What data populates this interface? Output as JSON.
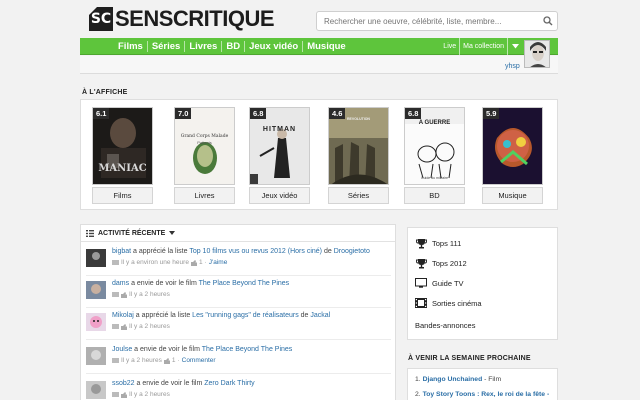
{
  "brand": {
    "logo_mark": "SC",
    "logo_text": "SENSCRITIQUE"
  },
  "search": {
    "placeholder": "Rechercher une oeuvre, célébrité, liste, membre..."
  },
  "nav": {
    "items": [
      "Films",
      "Séries",
      "Livres",
      "BD",
      "Jeux vidéo",
      "Musique"
    ],
    "live_label": "Live",
    "collection_label": "Ma collection"
  },
  "user": {
    "username": "yhsp"
  },
  "affiche": {
    "title": "À L'AFFICHE",
    "cards": [
      {
        "rating": "6.1",
        "category": "Films",
        "poster_text": "MANIAC"
      },
      {
        "rating": "7.0",
        "category": "Livres",
        "poster_text": "Grand Corps Malade",
        "poster_sub": "Patients"
      },
      {
        "rating": "6.8",
        "category": "Jeux vidéo",
        "poster_text": "HITMAN"
      },
      {
        "rating": "4.6",
        "category": "Séries",
        "poster_text": "REVOLUTION"
      },
      {
        "rating": "6.8",
        "category": "BD",
        "poster_text": "A GUERRE",
        "poster_sub": "Guide du militaire"
      },
      {
        "rating": "5.9",
        "category": "Musique",
        "poster_text": ""
      }
    ]
  },
  "activity": {
    "title": "ACTIVITÉ RÉCENTE",
    "items": [
      {
        "user": "bigbat",
        "verb": " a apprécié la liste ",
        "target": "Top 10 films vus ou revus 2012 (Hors ciné)",
        "suffix": " de ",
        "target2": "Droogietoto",
        "time": "Il y a environ une heure",
        "count": "1",
        "action": "J'aime"
      },
      {
        "user": "dams",
        "verb": " a envie de voir le film ",
        "target": "The Place Beyond The Pines",
        "suffix": "",
        "target2": "",
        "time": "Il y a 2 heures",
        "count": "",
        "action": ""
      },
      {
        "user": "Mikolaj",
        "verb": " a apprécié la liste ",
        "target": "Les \"running gags\" de réalisateurs",
        "suffix": " de ",
        "target2": "Jackal",
        "time": "Il y a 2 heures",
        "count": "",
        "action": ""
      },
      {
        "user": "Joulse",
        "verb": " a envie de voir le film ",
        "target": "The Place Beyond The Pines",
        "suffix": "",
        "target2": "",
        "time": "Il y a 2 heures",
        "count": "1",
        "action": "Commenter"
      },
      {
        "user": "ssob22",
        "verb": " a envie de voir le film ",
        "target": "Zero Dark Thirty",
        "suffix": "",
        "target2": "",
        "time": "Il y a 2 heures",
        "count": "",
        "action": ""
      }
    ]
  },
  "sidebar": {
    "items": [
      {
        "label": "Tops 111",
        "icon": "trophy-icon"
      },
      {
        "label": "Tops 2012",
        "icon": "trophy-icon"
      },
      {
        "label": "Guide TV",
        "icon": "tv-icon"
      },
      {
        "label": "Sorties cinéma",
        "icon": "film-icon"
      },
      {
        "label": "Bandes-annonces",
        "icon": ""
      }
    ]
  },
  "upcoming": {
    "title": "À VENIR LA SEMAINE PROCHAINE",
    "items": [
      {
        "num": "1.",
        "title": "Django Unchained",
        "type": " - Film"
      },
      {
        "num": "2.",
        "title": "Toy Story Toons : Rex, le roi de la fête -",
        "type": ""
      }
    ]
  },
  "colors": {
    "accent_green": "#5ec53c",
    "link_blue": "#2a6ea6"
  }
}
